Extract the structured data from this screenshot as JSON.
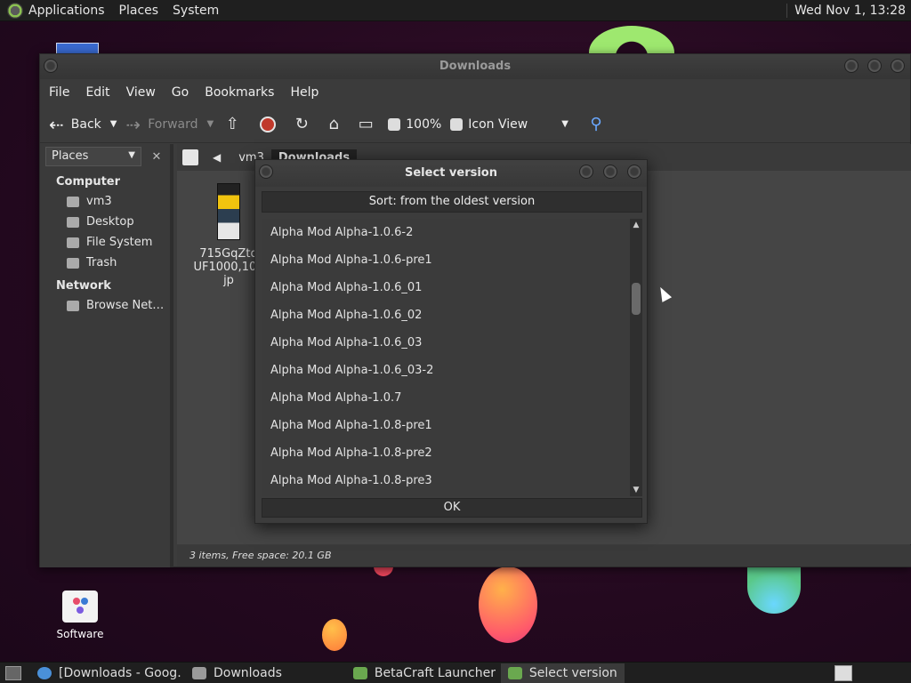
{
  "top_panel": {
    "menus": [
      "Applications",
      "Places",
      "System"
    ],
    "clock": "Wed Nov 1, 13:28"
  },
  "desktop": {
    "icons": [
      {
        "label": "Software"
      }
    ]
  },
  "fm": {
    "title": "Downloads",
    "menu": [
      "File",
      "Edit",
      "View",
      "Go",
      "Bookmarks",
      "Help"
    ],
    "toolbar": {
      "back": "Back",
      "forward": "Forward",
      "zoom": "100%",
      "view_mode": "Icon View"
    },
    "sidebar": {
      "selector": "Places",
      "sections": [
        {
          "title": "Computer",
          "items": [
            "vm3",
            "Desktop",
            "File System",
            "Trash"
          ]
        },
        {
          "title": "Network",
          "items": [
            "Browse Net…"
          ]
        }
      ]
    },
    "breadcrumbs": [
      "vm3",
      "Downloads"
    ],
    "file": {
      "name": "715GqZtq\nUF1000,100\njp"
    },
    "status": "3 items, Free space: 20.1 GB"
  },
  "dialog": {
    "title": "Select version",
    "sort_label": "Sort: from the oldest version",
    "versions": [
      "Alpha Mod Alpha-1.0.6-2",
      "Alpha Mod Alpha-1.0.6-pre1",
      "Alpha Mod Alpha-1.0.6_01",
      "Alpha Mod Alpha-1.0.6_02",
      "Alpha Mod Alpha-1.0.6_03",
      "Alpha Mod Alpha-1.0.6_03-2",
      "Alpha Mod Alpha-1.0.7",
      "Alpha Mod Alpha-1.0.8-pre1",
      "Alpha Mod Alpha-1.0.8-pre2",
      "Alpha Mod Alpha-1.0.8-pre3"
    ],
    "ok_label": "OK"
  },
  "taskbar": {
    "tasks": [
      {
        "label": "[Downloads - Goog…",
        "icon": "chrome-icon",
        "color": "#4a90d9"
      },
      {
        "label": "Downloads",
        "icon": "folder-icon",
        "color": "#9a9a9a"
      },
      {
        "label": "BetaCraft Launcher …",
        "icon": "betacraft-icon",
        "color": "#6aa84f"
      },
      {
        "label": "Select version",
        "icon": "betacraft-icon",
        "color": "#6aa84f"
      }
    ]
  }
}
